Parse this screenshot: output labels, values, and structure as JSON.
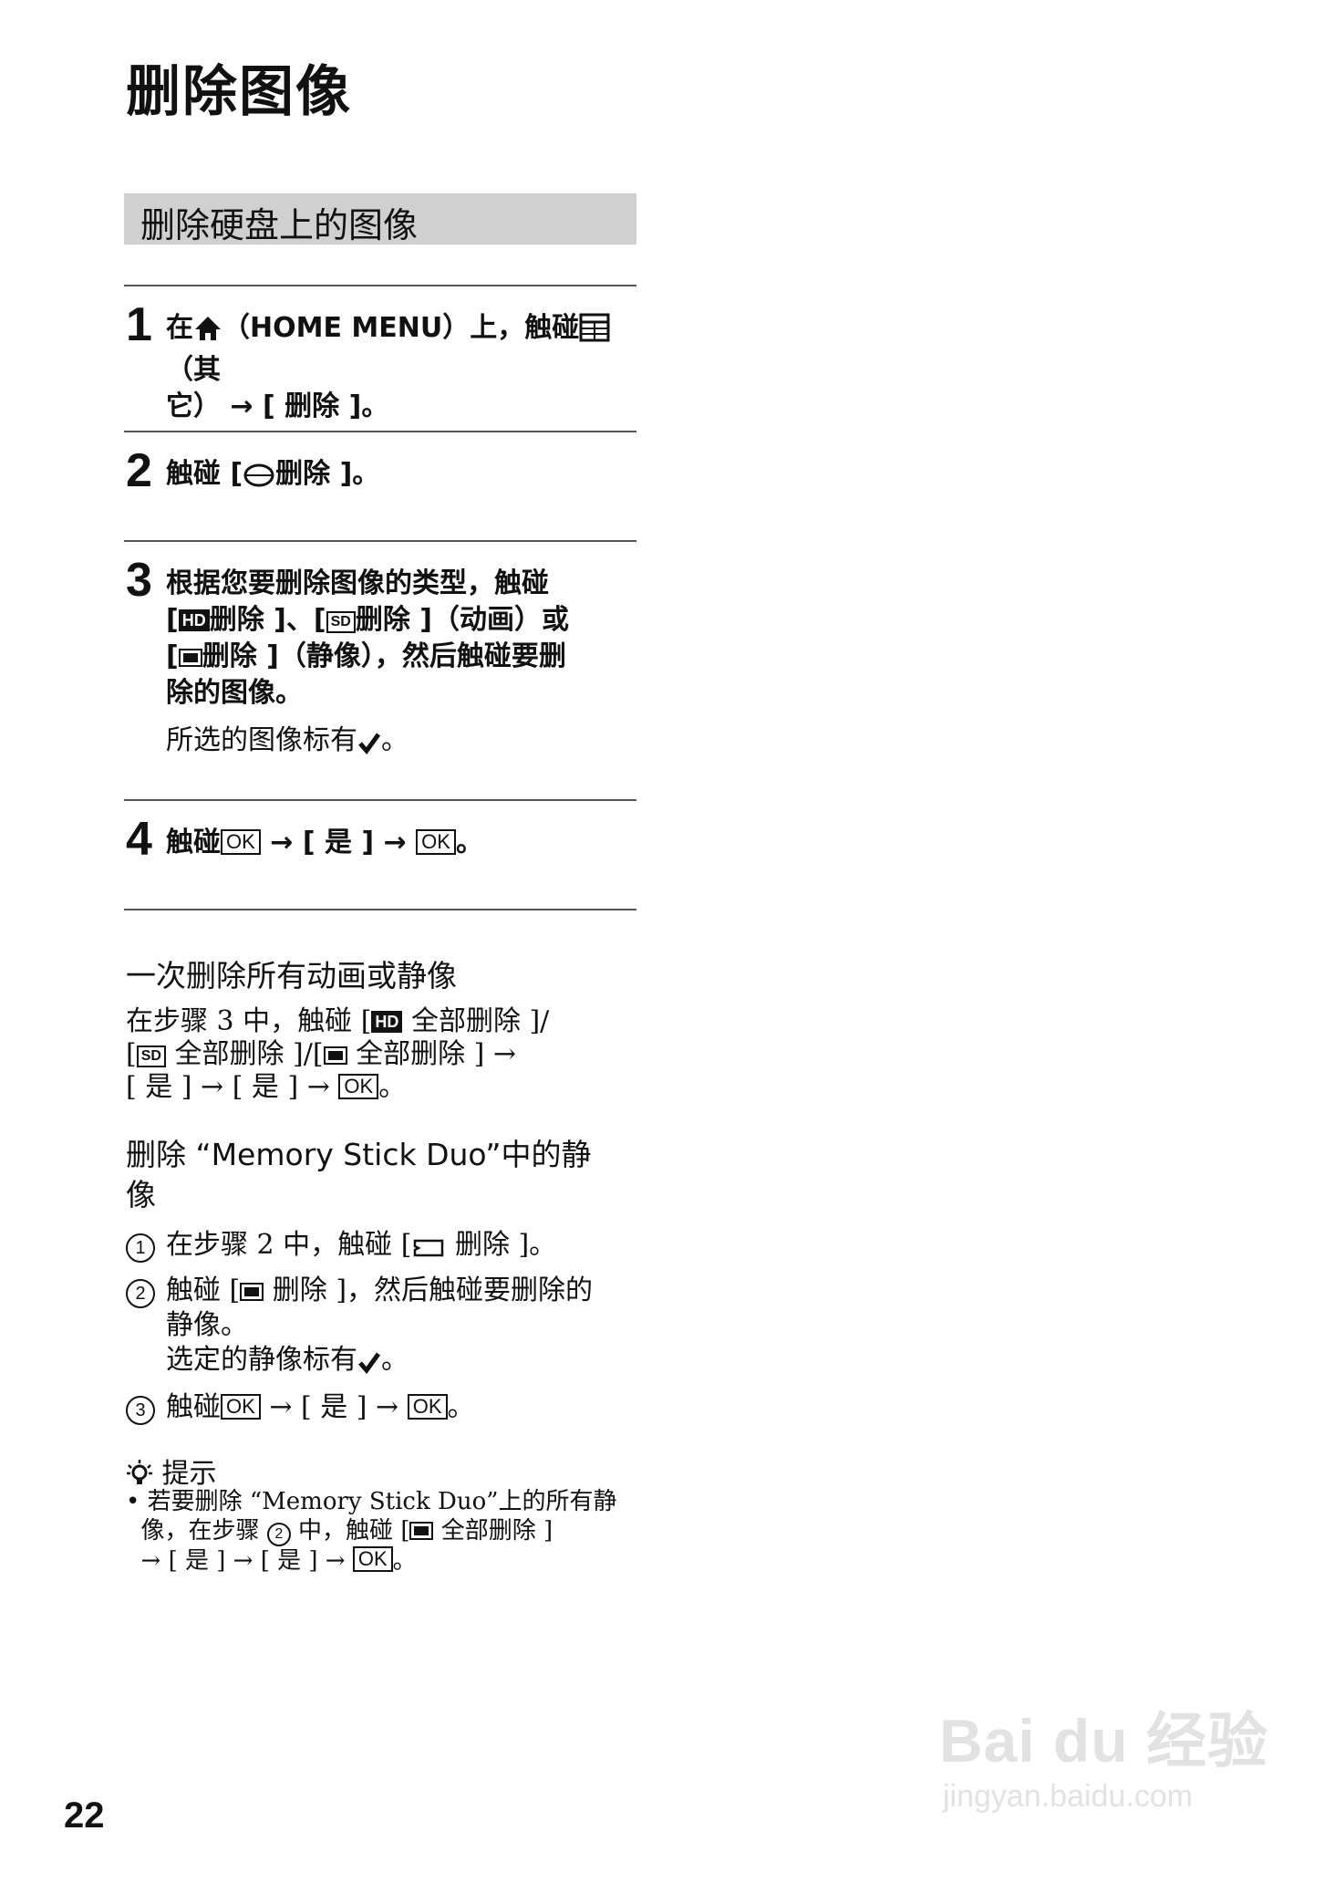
{
  "page": {
    "title": "删除图像",
    "section_title": "删除硬盘上的图像",
    "page_number": "22"
  },
  "steps": [
    {
      "num": "1",
      "a": "在",
      "b": "（HOME MENU）上，触碰",
      "c": "（其",
      "d": "它） → [ 删除 ]。"
    },
    {
      "num": "2",
      "a": "触碰 [",
      "b": "删除 ]。"
    },
    {
      "num": "3",
      "line1": "根据您要删除图像的类型，触碰",
      "l2a": "[",
      "hd": "HD",
      "l2b": "删除 ]、[",
      "sd": "SD",
      "l2c": "删除 ]（动画）或",
      "l3a": "[",
      "l3b": "删除 ]（静像），然后触碰要删",
      "line4": "除的图像。",
      "note": "所选的图像标有",
      "note_end": "。"
    },
    {
      "num": "4",
      "a": "触碰",
      "ok": "OK",
      "b": " → [ 是 ] → ",
      "end": "。"
    }
  ],
  "bulk_delete": {
    "heading": "一次删除所有动画或静像",
    "l1a": "在步骤 3 中，触碰 [",
    "hd": "HD",
    "l1b": " 全部删除 ]/",
    "l2a": "[",
    "sd": "SD",
    "l2b": " 全部删除 ]/[",
    "l2c": " 全部删除 ] →",
    "l3a": "[ 是 ] → [ 是 ] → ",
    "ok": "OK",
    "l3b": "。"
  },
  "memory_stick": {
    "heading_a": "删除 “Memory Stick Duo”中的静",
    "heading_b": "像",
    "items": [
      {
        "num": "1",
        "a": "在步骤 2 中，触碰 [",
        "b": " 删除 ]。"
      },
      {
        "num": "2",
        "a": "触碰 [",
        "b": " 删除 ]，然后触碰要删除的",
        "c": "静像。",
        "d": "选定的静像标有",
        "e": "。"
      },
      {
        "num": "3",
        "a": "触碰",
        "ok": "OK",
        "b": " → [ 是 ] → ",
        "c": "。"
      }
    ]
  },
  "tips": {
    "label": "提示",
    "l1": "• 若要删除 “Memory Stick Duo”上的所有静",
    "l2a": "像，在步骤 ",
    "circ": "2",
    "l2b": " 中，触碰 [",
    "l2c": " 全部删除 ]",
    "l3a": "→ [ 是 ] → [ 是 ] → ",
    "ok": "OK",
    "l3b": "。"
  },
  "watermark": {
    "brand": "Bai du 经验",
    "url": "jingyan.baidu.com"
  },
  "icons": [
    "home-icon",
    "other-menu-icon",
    "disc-icon",
    "hd-badge-icon",
    "sd-badge-icon",
    "still-image-icon",
    "checkmark-icon",
    "memory-stick-icon",
    "lightbulb-icon"
  ]
}
